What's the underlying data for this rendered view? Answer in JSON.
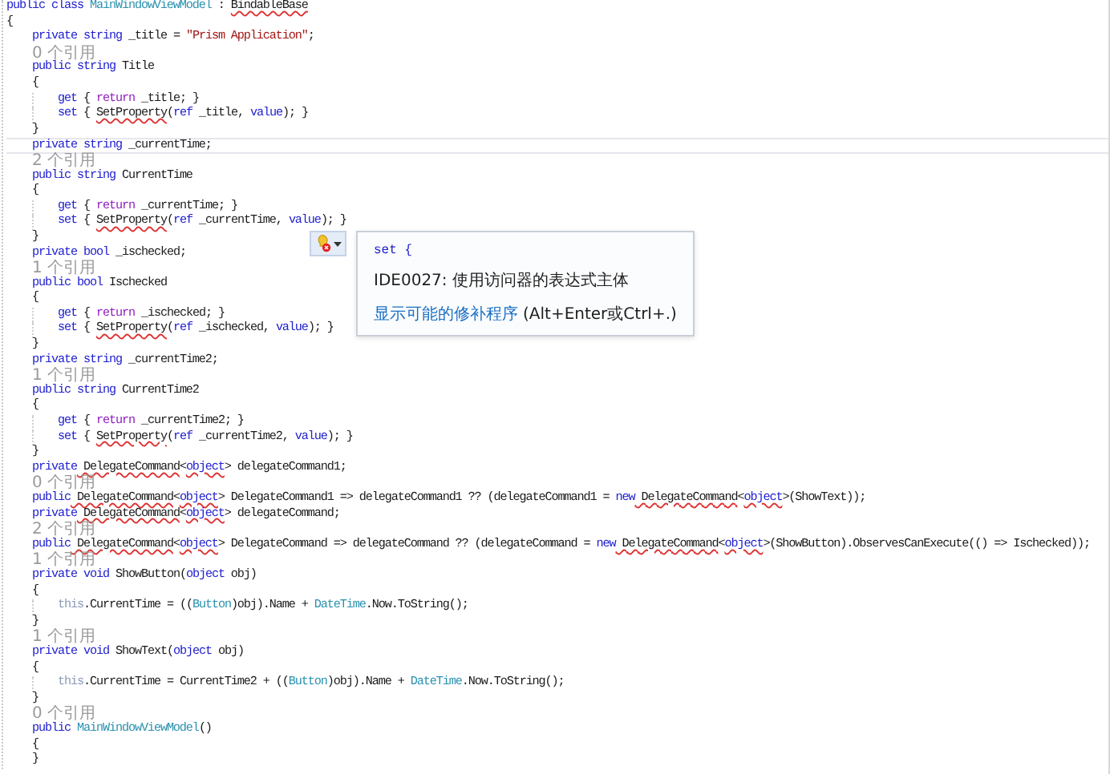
{
  "editor": {
    "lines": [
      {
        "kind": "code",
        "current": false,
        "tokens": [
          {
            "text": "public",
            "kind": "keyword"
          },
          {
            "text": " class",
            "kind": "keyword"
          },
          {
            "text": " MainWindowViewModel",
            "kind": "type"
          },
          {
            "text": " : ",
            "kind": "plain"
          },
          {
            "text": "BindableBase",
            "kind": "plain",
            "squiggle": true
          }
        ]
      },
      {
        "kind": "code",
        "current": false,
        "tokens": [
          {
            "text": "{",
            "kind": "plain"
          }
        ],
        "children": [
          {
            "kind": "code",
            "current": false,
            "tokens": [
              {
                "text": "private",
                "kind": "keyword"
              },
              {
                "text": " string",
                "kind": "keyword"
              },
              {
                "text": " _title = ",
                "kind": "plain"
              },
              {
                "text": "\"Prism Application\"",
                "kind": "string"
              },
              {
                "text": ";",
                "kind": "plain"
              }
            ]
          },
          {
            "kind": "lens",
            "current": false,
            "text": "0 个引用"
          },
          {
            "kind": "code",
            "current": false,
            "tokens": [
              {
                "text": "public",
                "kind": "keyword"
              },
              {
                "text": " string",
                "kind": "keyword"
              },
              {
                "text": " Title",
                "kind": "plain"
              }
            ]
          },
          {
            "kind": "code",
            "current": false,
            "tokens": [
              {
                "text": "{",
                "kind": "plain"
              }
            ],
            "children": [
              {
                "kind": "code",
                "current": false,
                "tokens": [
                  {
                    "text": "get",
                    "kind": "keyword"
                  },
                  {
                    "text": " { ",
                    "kind": "plain"
                  },
                  {
                    "text": "return",
                    "kind": "control"
                  },
                  {
                    "text": " _title; }",
                    "kind": "plain"
                  }
                ]
              },
              {
                "kind": "code",
                "current": false,
                "tokens": [
                  {
                    "text": "set",
                    "kind": "keyword"
                  },
                  {
                    "text": " { ",
                    "kind": "plain"
                  },
                  {
                    "text": "SetProperty",
                    "kind": "plain",
                    "squiggle": true
                  },
                  {
                    "text": "(",
                    "kind": "plain"
                  },
                  {
                    "text": "ref",
                    "kind": "keyword"
                  },
                  {
                    "text": " _title, ",
                    "kind": "plain"
                  },
                  {
                    "text": "value",
                    "kind": "keyword"
                  },
                  {
                    "text": "); }",
                    "kind": "plain"
                  }
                ]
              }
            ]
          },
          {
            "kind": "code",
            "current": false,
            "tokens": [
              {
                "text": "}",
                "kind": "plain"
              }
            ]
          },
          {
            "kind": "code",
            "current": true,
            "tokens": [
              {
                "text": "private",
                "kind": "keyword"
              },
              {
                "text": " string",
                "kind": "keyword"
              },
              {
                "text": " _currentTime;",
                "kind": "plain"
              }
            ]
          },
          {
            "kind": "lens",
            "current": false,
            "text": "2 个引用"
          },
          {
            "kind": "code",
            "current": false,
            "tokens": [
              {
                "text": "public",
                "kind": "keyword"
              },
              {
                "text": " string",
                "kind": "keyword"
              },
              {
                "text": " CurrentTime",
                "kind": "plain"
              }
            ]
          },
          {
            "kind": "code",
            "current": false,
            "tokens": [
              {
                "text": "{",
                "kind": "plain"
              }
            ],
            "children": [
              {
                "kind": "code",
                "current": false,
                "tokens": [
                  {
                    "text": "get",
                    "kind": "keyword"
                  },
                  {
                    "text": " { ",
                    "kind": "plain"
                  },
                  {
                    "text": "return",
                    "kind": "control"
                  },
                  {
                    "text": " _currentTime; }",
                    "kind": "plain"
                  }
                ]
              },
              {
                "kind": "code",
                "current": false,
                "tokens": [
                  {
                    "text": "set",
                    "kind": "keyword"
                  },
                  {
                    "text": " { ",
                    "kind": "plain"
                  },
                  {
                    "text": "SetProperty",
                    "kind": "plain",
                    "squiggle": true
                  },
                  {
                    "text": "(",
                    "kind": "plain"
                  },
                  {
                    "text": "ref",
                    "kind": "keyword"
                  },
                  {
                    "text": " _currentTime, ",
                    "kind": "plain"
                  },
                  {
                    "text": "value",
                    "kind": "keyword"
                  },
                  {
                    "text": "); }",
                    "kind": "plain"
                  }
                ]
              }
            ]
          },
          {
            "kind": "code",
            "current": false,
            "tokens": [
              {
                "text": "}",
                "kind": "plain"
              }
            ]
          },
          {
            "kind": "code",
            "current": false,
            "tokens": [
              {
                "text": "private",
                "kind": "keyword"
              },
              {
                "text": " bool",
                "kind": "keyword"
              },
              {
                "text": " _ischecked;",
                "kind": "plain"
              }
            ]
          },
          {
            "kind": "lens",
            "current": false,
            "text": "1 个引用"
          },
          {
            "kind": "code",
            "current": false,
            "tokens": [
              {
                "text": "public",
                "kind": "keyword"
              },
              {
                "text": " bool",
                "kind": "keyword"
              },
              {
                "text": " Ischecked",
                "kind": "plain"
              }
            ]
          },
          {
            "kind": "code",
            "current": false,
            "tokens": [
              {
                "text": "{",
                "kind": "plain"
              }
            ],
            "children": [
              {
                "kind": "code",
                "current": false,
                "tokens": [
                  {
                    "text": "get",
                    "kind": "keyword"
                  },
                  {
                    "text": " { ",
                    "kind": "plain"
                  },
                  {
                    "text": "return",
                    "kind": "control"
                  },
                  {
                    "text": " _ischecked; }",
                    "kind": "plain"
                  }
                ]
              },
              {
                "kind": "code",
                "current": false,
                "tokens": [
                  {
                    "text": "set",
                    "kind": "keyword"
                  },
                  {
                    "text": " { ",
                    "kind": "plain"
                  },
                  {
                    "text": "SetProperty",
                    "kind": "plain",
                    "squiggle": true
                  },
                  {
                    "text": "(",
                    "kind": "plain"
                  },
                  {
                    "text": "ref",
                    "kind": "keyword"
                  },
                  {
                    "text": " _ischecked, ",
                    "kind": "plain"
                  },
                  {
                    "text": "value",
                    "kind": "keyword"
                  },
                  {
                    "text": "); }",
                    "kind": "plain"
                  }
                ]
              }
            ]
          },
          {
            "kind": "code",
            "current": false,
            "tokens": [
              {
                "text": "}",
                "kind": "plain"
              }
            ]
          },
          {
            "kind": "code",
            "current": false,
            "tokens": [
              {
                "text": "private",
                "kind": "keyword"
              },
              {
                "text": " string",
                "kind": "keyword"
              },
              {
                "text": " _currentTime2;",
                "kind": "plain"
              }
            ]
          },
          {
            "kind": "lens",
            "current": false,
            "text": "1 个引用"
          },
          {
            "kind": "code",
            "current": false,
            "tokens": [
              {
                "text": "public",
                "kind": "keyword"
              },
              {
                "text": " string",
                "kind": "keyword"
              },
              {
                "text": " CurrentTime2",
                "kind": "plain"
              }
            ]
          },
          {
            "kind": "code",
            "current": false,
            "tokens": [
              {
                "text": "{",
                "kind": "plain"
              }
            ],
            "children": [
              {
                "kind": "code",
                "current": false,
                "tokens": [
                  {
                    "text": "get",
                    "kind": "keyword"
                  },
                  {
                    "text": " { ",
                    "kind": "plain"
                  },
                  {
                    "text": "return",
                    "kind": "control"
                  },
                  {
                    "text": " _currentTime2; }",
                    "kind": "plain"
                  }
                ]
              },
              {
                "kind": "code",
                "current": false,
                "tokens": [
                  {
                    "text": "set",
                    "kind": "keyword"
                  },
                  {
                    "text": " { ",
                    "kind": "plain"
                  },
                  {
                    "text": "SetProperty",
                    "kind": "plain",
                    "squiggle": true
                  },
                  {
                    "text": "(",
                    "kind": "plain"
                  },
                  {
                    "text": "ref",
                    "kind": "keyword"
                  },
                  {
                    "text": " _currentTime2, ",
                    "kind": "plain"
                  },
                  {
                    "text": "value",
                    "kind": "keyword"
                  },
                  {
                    "text": "); }",
                    "kind": "plain"
                  }
                ]
              }
            ]
          },
          {
            "kind": "code",
            "current": false,
            "tokens": [
              {
                "text": "}",
                "kind": "plain"
              }
            ]
          },
          {
            "kind": "code",
            "current": false,
            "tokens": [
              {
                "text": "private",
                "kind": "keyword"
              },
              {
                "text": " DelegateCommand",
                "kind": "plain",
                "squiggle": true
              },
              {
                "text": "<",
                "kind": "plain"
              },
              {
                "text": "object",
                "kind": "keyword",
                "squiggle": true
              },
              {
                "text": "> delegateCommand1;",
                "kind": "plain"
              }
            ]
          },
          {
            "kind": "lens",
            "current": false,
            "text": "0 个引用"
          },
          {
            "kind": "code",
            "current": false,
            "tokens": [
              {
                "text": "public",
                "kind": "keyword"
              },
              {
                "text": " DelegateCommand",
                "kind": "plain",
                "squiggle": true
              },
              {
                "text": "<",
                "kind": "plain"
              },
              {
                "text": "object",
                "kind": "keyword",
                "squiggle": true
              },
              {
                "text": "> DelegateCommand1 => delegateCommand1 ?? (delegateCommand1 = ",
                "kind": "plain"
              },
              {
                "text": "new",
                "kind": "keyword"
              },
              {
                "text": " DelegateCommand",
                "kind": "plain",
                "squiggle": true
              },
              {
                "text": "<",
                "kind": "plain"
              },
              {
                "text": "object",
                "kind": "keyword",
                "squiggle": true
              },
              {
                "text": ">(ShowText));",
                "kind": "plain"
              }
            ]
          },
          {
            "kind": "code",
            "current": false,
            "tokens": [
              {
                "text": "private",
                "kind": "keyword"
              },
              {
                "text": " DelegateCommand",
                "kind": "plain",
                "squiggle": true
              },
              {
                "text": "<",
                "kind": "plain"
              },
              {
                "text": "object",
                "kind": "keyword",
                "squiggle": true
              },
              {
                "text": "> delegateCommand;",
                "kind": "plain"
              }
            ]
          },
          {
            "kind": "lens",
            "current": false,
            "text": "2 个引用"
          },
          {
            "kind": "code",
            "current": false,
            "tokens": [
              {
                "text": "public",
                "kind": "keyword"
              },
              {
                "text": " DelegateCommand",
                "kind": "plain",
                "squiggle": true
              },
              {
                "text": "<",
                "kind": "plain"
              },
              {
                "text": "object",
                "kind": "keyword",
                "squiggle": true
              },
              {
                "text": "> DelegateCommand => delegateCommand ?? (delegateCommand = ",
                "kind": "plain"
              },
              {
                "text": "new",
                "kind": "keyword"
              },
              {
                "text": " DelegateCommand",
                "kind": "plain",
                "squiggle": true
              },
              {
                "text": "<",
                "kind": "plain"
              },
              {
                "text": "object",
                "kind": "keyword",
                "squiggle": true
              },
              {
                "text": ">(ShowButton).ObservesCanExecute(() => Ischecked));",
                "kind": "plain"
              }
            ]
          },
          {
            "kind": "lens",
            "current": false,
            "text": "1 个引用"
          },
          {
            "kind": "code",
            "current": false,
            "tokens": [
              {
                "text": "private",
                "kind": "keyword"
              },
              {
                "text": " void",
                "kind": "keyword"
              },
              {
                "text": " ShowButton(",
                "kind": "plain"
              },
              {
                "text": "object",
                "kind": "keyword"
              },
              {
                "text": " obj)",
                "kind": "plain"
              }
            ]
          },
          {
            "kind": "code",
            "current": false,
            "tokens": [
              {
                "text": "{",
                "kind": "plain"
              }
            ],
            "children": [
              {
                "kind": "code",
                "current": false,
                "tokens": [
                  {
                    "text": "this",
                    "kind": "faded"
                  },
                  {
                    "text": ".CurrentTime = ((",
                    "kind": "plain"
                  },
                  {
                    "text": "Button",
                    "kind": "type"
                  },
                  {
                    "text": ")obj).Name + ",
                    "kind": "plain"
                  },
                  {
                    "text": "DateTime",
                    "kind": "type"
                  },
                  {
                    "text": ".Now.ToString();",
                    "kind": "plain"
                  }
                ]
              }
            ]
          },
          {
            "kind": "code",
            "current": false,
            "tokens": [
              {
                "text": "}",
                "kind": "plain"
              }
            ]
          },
          {
            "kind": "lens",
            "current": false,
            "text": "1 个引用"
          },
          {
            "kind": "code",
            "current": false,
            "tokens": [
              {
                "text": "private",
                "kind": "keyword"
              },
              {
                "text": " void",
                "kind": "keyword"
              },
              {
                "text": " ShowText(",
                "kind": "plain"
              },
              {
                "text": "object",
                "kind": "keyword"
              },
              {
                "text": " obj)",
                "kind": "plain"
              }
            ]
          },
          {
            "kind": "code",
            "current": false,
            "tokens": [
              {
                "text": "{",
                "kind": "plain"
              }
            ],
            "children": [
              {
                "kind": "code",
                "current": false,
                "tokens": [
                  {
                    "text": "this",
                    "kind": "faded"
                  },
                  {
                    "text": ".CurrentTime = CurrentTime2 + ((",
                    "kind": "plain"
                  },
                  {
                    "text": "Button",
                    "kind": "type"
                  },
                  {
                    "text": ")obj).Name + ",
                    "kind": "plain"
                  },
                  {
                    "text": "DateTime",
                    "kind": "type"
                  },
                  {
                    "text": ".Now.ToString();",
                    "kind": "plain"
                  }
                ]
              }
            ]
          },
          {
            "kind": "code",
            "current": false,
            "tokens": [
              {
                "text": "}",
                "kind": "plain"
              }
            ]
          },
          {
            "kind": "lens",
            "current": false,
            "text": "0 个引用"
          },
          {
            "kind": "code",
            "current": false,
            "tokens": [
              {
                "text": "public",
                "kind": "keyword"
              },
              {
                "text": " MainWindowViewModel",
                "kind": "type"
              },
              {
                "text": "()",
                "kind": "plain"
              }
            ]
          },
          {
            "kind": "code",
            "current": false,
            "tokens": [
              {
                "text": "{",
                "kind": "plain"
              }
            ]
          },
          {
            "kind": "code",
            "current": false,
            "tokens": [
              {
                "text": "}",
                "kind": "plain"
              }
            ]
          }
        ]
      }
    ]
  },
  "quick_info": {
    "code": "set {",
    "message": "IDE0027: 使用访问器的表达式主体",
    "link": "显示可能的修补程序",
    "shortcut": "(Alt+Enter或Ctrl+.)"
  }
}
